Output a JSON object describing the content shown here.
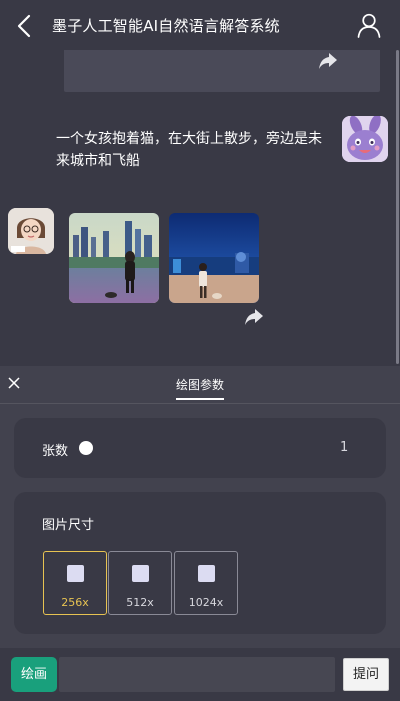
{
  "header": {
    "title": "墨子人工智能AI自然语言解答系统",
    "back_icon": "chevron-left-icon",
    "user_icon": "user-icon"
  },
  "chat": {
    "messages": [
      {
        "role": "user",
        "text": "一个女孩抱着猫，在大街上散步，旁边是未来城市和飞船",
        "avatar": "cartoon-rabbit-avatar"
      },
      {
        "role": "bot",
        "avatar": "girl-with-glasses-avatar",
        "images": [
          "generated-image-city-street-girl-dog",
          "generated-image-night-city-girl-dog"
        ]
      }
    ],
    "share_icon": "share-arrow-icon"
  },
  "sheet": {
    "title": "绘图参数",
    "count": {
      "label": "张数",
      "value": "1",
      "slider_fraction": 0
    },
    "size": {
      "label": "图片尺寸",
      "options": [
        "256x",
        "512x",
        "1024x"
      ],
      "selected": "256x"
    }
  },
  "input_bar": {
    "draw_label": "绘画",
    "input_value": "",
    "input_placeholder": "",
    "ask_label": "提问"
  },
  "colors": {
    "background": "#393945",
    "sheet": "#42424e",
    "accent_green": "#19a07c",
    "selected_gold": "#e7c352"
  }
}
